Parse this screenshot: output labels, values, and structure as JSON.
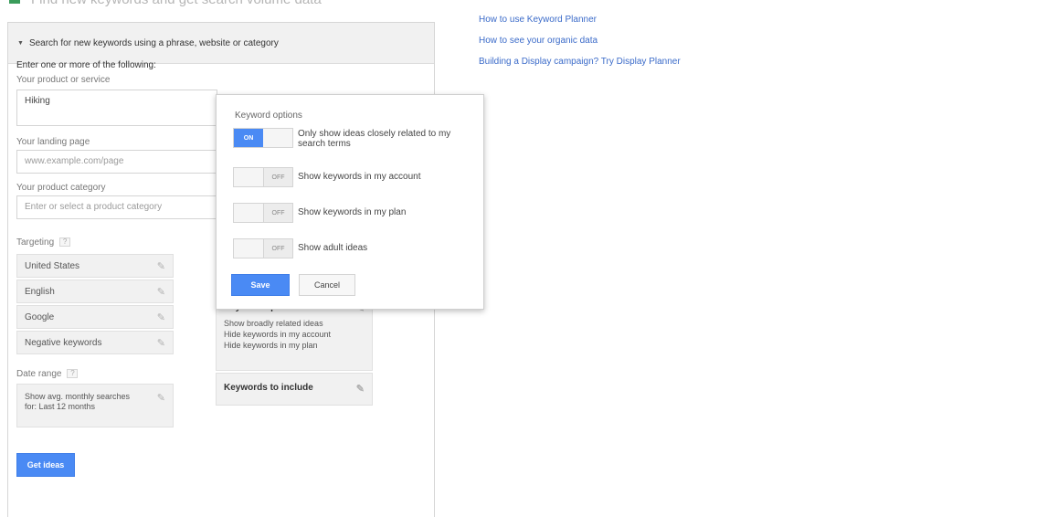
{
  "header": {
    "title_partial": "Find new keywords and get search volume data"
  },
  "help_links": [
    "How to use Keyword Planner",
    "How to see your organic data",
    "Building a Display campaign? Try Display Planner"
  ],
  "search_section": {
    "header_label": "Search for new keywords using a phrase, website or category",
    "intro": "Enter one or more of the following:",
    "product": {
      "label": "Your product or service",
      "value": "Hiking"
    },
    "landing": {
      "label": "Your landing page",
      "placeholder": "www.example.com/page"
    },
    "category": {
      "label": "Your product category",
      "placeholder": "Enter or select a product category"
    },
    "targeting": {
      "label": "Targeting",
      "help": "?",
      "items": [
        "United States",
        "English",
        "Google",
        "Negative keywords"
      ]
    },
    "date_range": {
      "label": "Date range",
      "help": "?",
      "value": "Show avg. monthly searches for: Last 12 months"
    },
    "get_ideas_label": "Get ideas"
  },
  "customize": {
    "keyword_options": {
      "title": "Keyword options",
      "lines": [
        "Show broadly related ideas",
        "Hide keywords in my account",
        "Hide keywords in my plan"
      ]
    },
    "keywords_to_include": {
      "title": "Keywords to include"
    }
  },
  "popup": {
    "title": "Keyword options",
    "options": [
      {
        "label": "Only show ideas closely related to my search terms",
        "state": "ON"
      },
      {
        "label": "Show keywords in my account",
        "state": "OFF"
      },
      {
        "label": "Show keywords in my plan",
        "state": "OFF"
      },
      {
        "label": "Show adult ideas",
        "state": "OFF"
      }
    ],
    "save_label": "Save",
    "cancel_label": "Cancel"
  },
  "colors": {
    "accent_blue": "#4a8af4",
    "link_blue": "#3b6bc9",
    "brand_green": "#3a9c5b"
  },
  "icons": {
    "edit": "pencil-icon",
    "expand": "caret-down-icon"
  }
}
